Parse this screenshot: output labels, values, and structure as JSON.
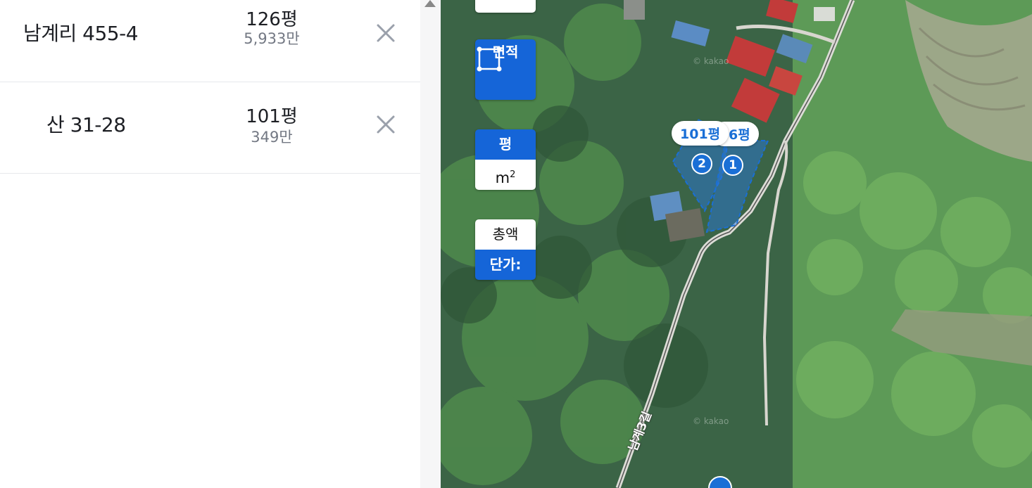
{
  "list": {
    "items": [
      {
        "address": "남계리 455-4",
        "area": "126평",
        "price": "5,933만"
      },
      {
        "address": "산 31-28",
        "area": "101평",
        "price": "349만"
      }
    ]
  },
  "controls": {
    "area_label": "면적",
    "unit_pyeong": "평",
    "unit_sqm": "m",
    "unit_sqm_sup": "2",
    "total_label": "총액",
    "unit_price_label": "단가:"
  },
  "map": {
    "parcel_labels": [
      {
        "text": "101평",
        "number": "2"
      },
      {
        "text": "6평",
        "number": "1"
      }
    ],
    "road_name": "남계3길",
    "watermark": "© kakao",
    "colors": {
      "parcel": "#1a6fd6",
      "control_active": "#1565d8"
    }
  }
}
